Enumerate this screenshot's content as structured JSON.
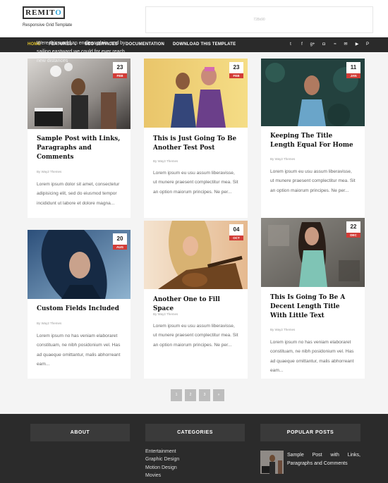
{
  "header": {
    "logo_prefix": "REMIT",
    "logo_o": "O",
    "tagline": "Responsive Grid Template",
    "ad_label": "728x90"
  },
  "nav": {
    "items": [
      "HOME",
      "FEATURES ⌄",
      "SEO SERVICES",
      "DOCUMENTATION",
      "DOWNLOAD THIS TEMPLATE"
    ],
    "social_icons": [
      "twitter-icon",
      "facebook-icon",
      "google-plus-icon",
      "instagram-icon",
      "rss-icon",
      "email-icon",
      "youtube-icon",
      "pinterest-icon"
    ],
    "social_glyphs": [
      "t",
      "f",
      "g+",
      "◘",
      "≈",
      "✉",
      "▶",
      "P"
    ]
  },
  "posts": [
    {
      "day": "23",
      "month": "FEB",
      "title": "Sample Post with Links, Paragraphs and Comments",
      "author": "By Way2 Themes",
      "excerpt": "Lorem ipsum dolor sit amet, consectetur adipisicing elit, sed do eiusmod tempor incididunt ut labore et dolore magna..."
    },
    {
      "day": "23",
      "month": "FEB",
      "title": "This is Just Going To Be Another Test Post",
      "author": "By Way2 Themes",
      "excerpt": "Lorem ipsum eu usu assum liberavisse, ut munere praesent complectitur mea. Sit an option maiorum principes. Ne per..."
    },
    {
      "day": "11",
      "month": "JAN",
      "title": "Keeping The Title Length Equal For Home",
      "author": "By Way2 Themes",
      "excerpt": "Lorem ipsum eu usu assum liberavisse, ut munere praesent complectitur mea. Sit an option maiorum principes. Ne per..."
    },
    {
      "day": "20",
      "month": "AUG",
      "title": "Custom Fields Included",
      "author": "By Way2 Themes",
      "excerpt": "Lorem ipsum no has veniam elaboraret constituam, ne nibh posidonium vel. Has ad quaeque omittantur, malis abhorreant eam..."
    },
    {
      "day": "04",
      "month": "OCT",
      "title": "Another One to Fill Space",
      "author": "By Way2 Themes",
      "excerpt": "Lorem ipsum eu usu assum liberavisse, ut munere praesent complectitur mea. Sit an option maiorum principes. Ne per..."
    },
    {
      "day": "22",
      "month": "DEC",
      "title": "This Is Going To Be A Decent Length Title With Little Text",
      "author": "By Way2 Themes",
      "excerpt": "Lorem ipsum no has veniam elaboraret constituam, ne nibh posidonium vel. Has ad quaeque omittantur, malis abhorreant eam..."
    }
  ],
  "pagination": [
    "1",
    "2",
    "3",
    "»"
  ],
  "footer": {
    "about": {
      "heading": "ABOUT",
      "text": "Were this world an endless plain, and by sailing eastward we could for ever reach new distances"
    },
    "categories": {
      "heading": "CATEGORIES",
      "items": [
        "Entertainment",
        "Graphic Design",
        "Motion Design",
        "Movies"
      ]
    },
    "popular": {
      "heading": "POPULAR POSTS",
      "item_title": "Sample Post with Links, Paragraphs and Comments"
    }
  },
  "colors": {
    "accent": "#e3c329",
    "date_badge": "#d23c37",
    "nav_bg": "#2a2a2a",
    "footer_bg": "#2b2b2b"
  }
}
